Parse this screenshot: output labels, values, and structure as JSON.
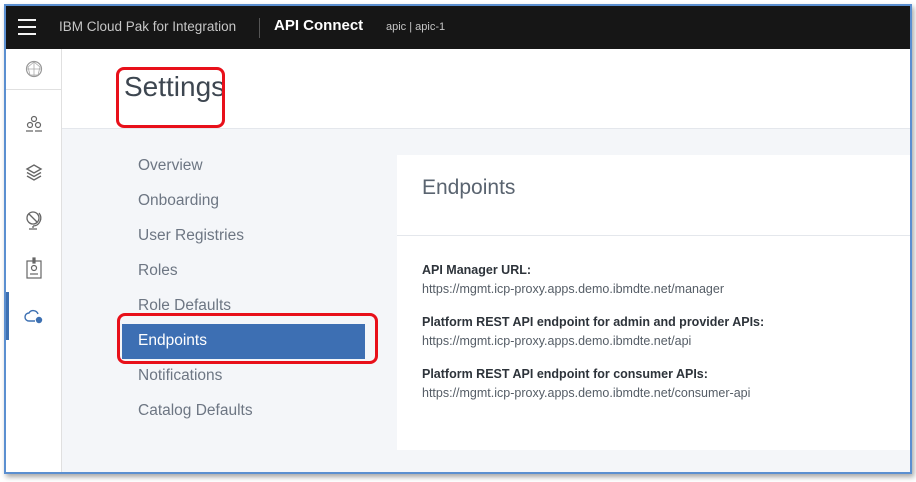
{
  "topbar": {
    "brand": "IBM Cloud Pak for Integration",
    "product": "API Connect",
    "instance": "apic | apic-1",
    "menu_icon": "hamburger-icon"
  },
  "rail": {
    "icons": [
      "dashboard-icon",
      "provider-orgs-icon",
      "resources-icon",
      "topology-icon",
      "member-badge-icon",
      "cloud-settings-icon"
    ],
    "active": "cloud-settings-icon"
  },
  "page": {
    "title": "Settings"
  },
  "nav": {
    "items": [
      {
        "label": "Overview"
      },
      {
        "label": "Onboarding"
      },
      {
        "label": "User Registries"
      },
      {
        "label": "Roles"
      },
      {
        "label": "Role Defaults"
      },
      {
        "label": "Endpoints",
        "active": true
      },
      {
        "label": "Notifications"
      },
      {
        "label": "Catalog Defaults"
      }
    ]
  },
  "card": {
    "title": "Endpoints",
    "fields": [
      {
        "label": "API Manager URL:",
        "value": "https://mgmt.icp-proxy.apps.demo.ibmdte.net/manager"
      },
      {
        "label": "Platform REST API endpoint for admin and provider APIs:",
        "value": "https://mgmt.icp-proxy.apps.demo.ibmdte.net/api"
      },
      {
        "label": "Platform REST API endpoint for consumer APIs:",
        "value": "https://mgmt.icp-proxy.apps.demo.ibmdte.net/consumer-api"
      }
    ]
  },
  "colors": {
    "accent": "#3d6fb3",
    "topbar": "#161616",
    "annotation": "#e8101a"
  }
}
